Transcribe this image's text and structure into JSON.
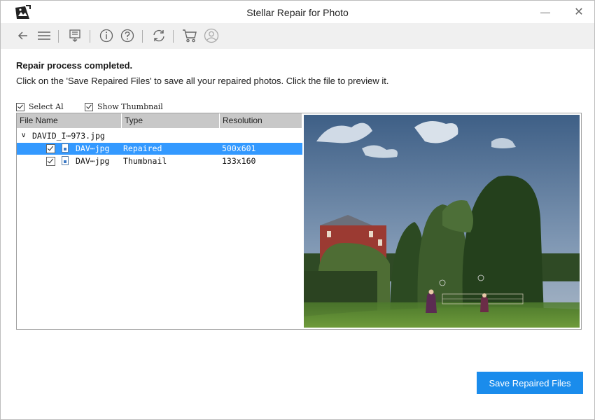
{
  "window": {
    "title": "Stellar Repair for Photo",
    "minimize_glyph": "—",
    "close_glyph": "✕"
  },
  "toolbar": {
    "icons": [
      "back-arrow-icon",
      "menu-icon",
      "save-file-icon",
      "info-icon",
      "help-icon",
      "refresh-icon",
      "cart-icon",
      "user-icon"
    ]
  },
  "main": {
    "heading": "Repair process completed.",
    "instruction": "Click on the 'Save Repaired Files' to save all your repaired photos. Click the file to preview it.",
    "select_all_label": "Select Al",
    "show_thumbnail_label": "Show Thumbnail"
  },
  "table": {
    "columns": [
      "File Name",
      "Type",
      "Resolution"
    ],
    "parent": {
      "expander": "∨",
      "name": "DAVID_I⋯973.jpg"
    },
    "rows": [
      {
        "name": "DAV⋯jpg",
        "type": "Repaired",
        "resolution": "500x601",
        "selected": true
      },
      {
        "name": "DAV⋯jpg",
        "type": "Thumbnail",
        "resolution": "133x160",
        "selected": false
      }
    ]
  },
  "actions": {
    "save_label": "Save Repaired Files"
  },
  "colors": {
    "accent": "#1a8cec",
    "selection": "#3399ff",
    "toolbar_bg": "#f0f0f0",
    "header_bg": "#c8c8c8"
  }
}
